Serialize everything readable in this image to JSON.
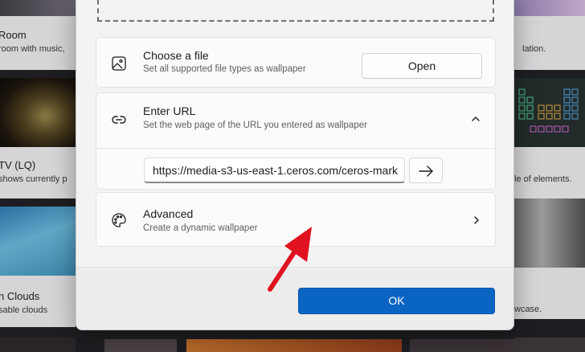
{
  "background": {
    "left_tiles": [
      {
        "title": "Room",
        "desc": "room with music,"
      },
      {
        "title": "TV (LQ)",
        "desc": "shows currently p"
      },
      {
        "title": "n Clouds",
        "desc": "sable clouds"
      }
    ],
    "right_tiles": [
      {
        "title": "",
        "desc": "lation."
      },
      {
        "title": "",
        "desc": "le of elements."
      },
      {
        "title": "",
        "desc": "wcase."
      }
    ]
  },
  "dialog": {
    "choose_file": {
      "title": "Choose a file",
      "desc": "Set all supported file types as wallpaper",
      "button": "Open",
      "icon": "image-icon"
    },
    "enter_url": {
      "title": "Enter URL",
      "desc": "Set the web page of the URL you entered as wallpaper",
      "icon": "link-icon",
      "url_value": "https://media-s3-us-east-1.ceros.com/ceros-mark",
      "go_icon": "arrow-right-icon"
    },
    "advanced": {
      "title": "Advanced",
      "desc": "Create a dynamic wallpaper",
      "icon": "palette-icon"
    },
    "ok_button": "OK"
  },
  "colors": {
    "accent": "#0a64c2",
    "annotation_arrow": "#e0121f"
  }
}
